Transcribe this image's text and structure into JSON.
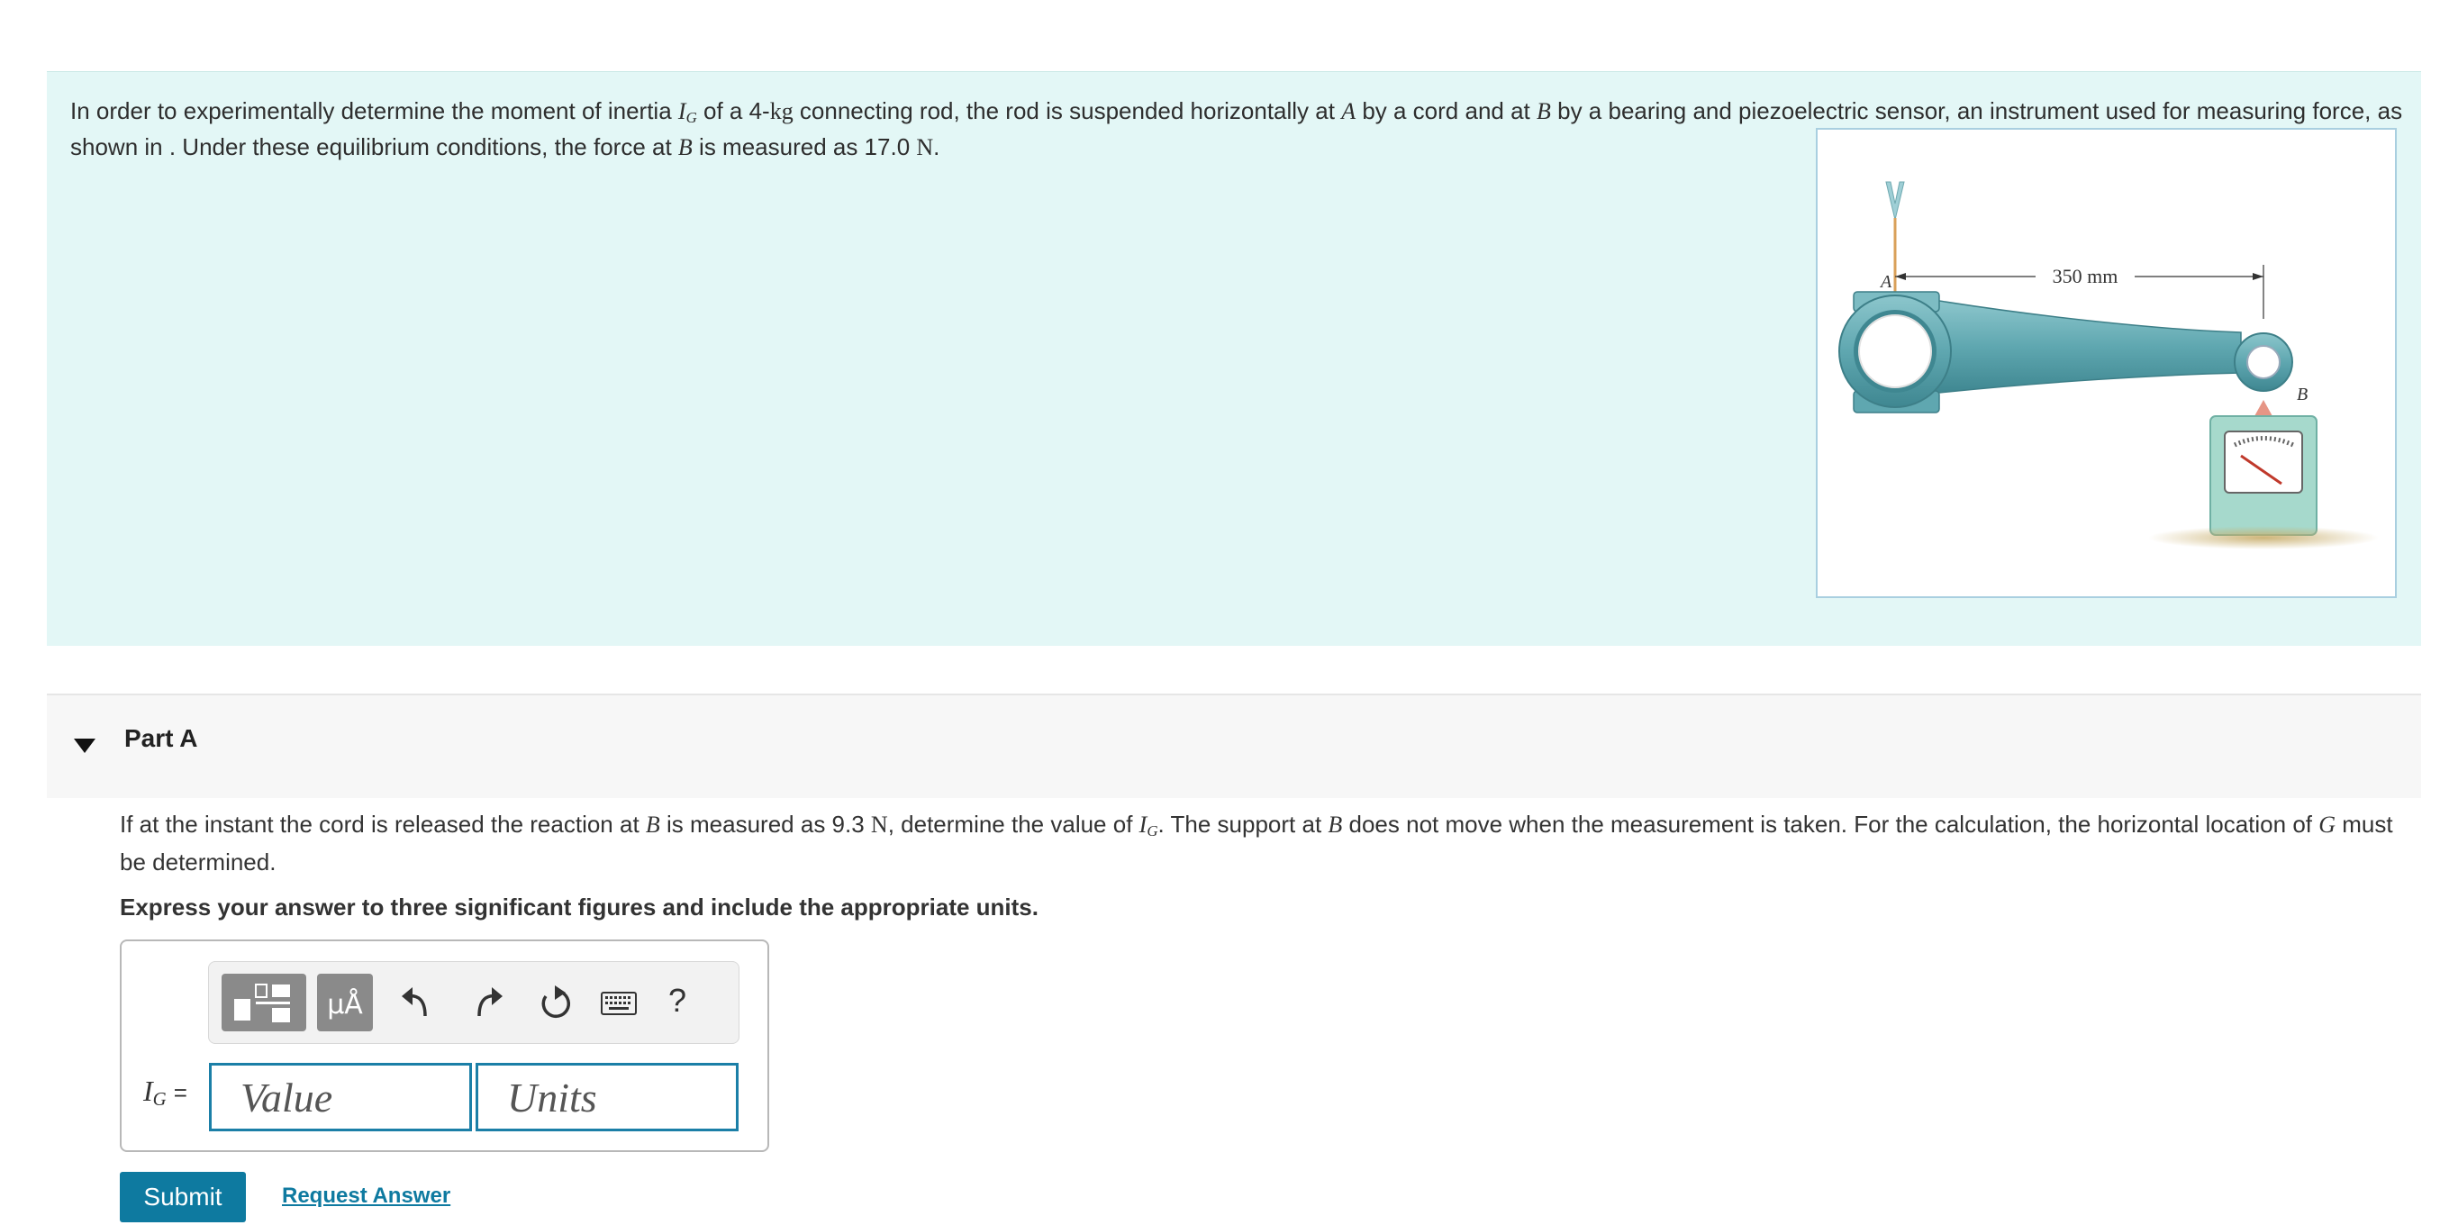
{
  "intro": {
    "text_1": "In order to experimentally determine the moment of inertia ",
    "ig_symbol": "I",
    "ig_sub": "G",
    "text_2": " of a 4-",
    "kg": "kg",
    "text_3": " connecting rod, the rod is suspended horizontally at ",
    "a_symbol": "A",
    "text_4": " by a cord and at ",
    "b_symbol": "B",
    "text_5": " by a bearing and piezoelectric sensor, an instrument used for measuring force, as shown in . Under these equilibrium conditions, the force at ",
    "b_symbol_2": "B",
    "text_6": " is measured as 17.0 ",
    "n_unit": "N",
    "text_7": "."
  },
  "figure": {
    "dimension_label": "350 mm",
    "label_a": "A",
    "label_b": "B",
    "colors": {
      "rod": "#5fa7b0",
      "rod_dark": "#3f8791",
      "cord": "#d9a05a",
      "sensor": "#a6d9cc",
      "shadow": "#c8ad6a",
      "tip": "#e69585"
    }
  },
  "partA": {
    "title": "Part A",
    "question": {
      "t1": "If at the instant the cord is released the reaction at ",
      "b": "B",
      "t2": " is measured as 9.3 ",
      "n": "N",
      "t3": ", determine the value of ",
      "ig": "I",
      "ig_sub": "G",
      "t4": ". The support at ",
      "b2": "B",
      "t5": " does not move when the measurement is taken. For the calculation, the horizontal location of ",
      "g": "G",
      "t6": " must be determined."
    },
    "instruction": "Express your answer to three significant figures and include the appropriate units.",
    "toolbar": {
      "units_label": "μÅ",
      "help_label": "?",
      "icons": [
        "templates-icon",
        "units-icon",
        "undo-icon",
        "redo-icon",
        "reset-icon",
        "keyboard-icon",
        "help-icon"
      ]
    },
    "answer": {
      "var_symbol": "I",
      "var_sub": "G",
      "equals": "=",
      "value_placeholder": "Value",
      "units_placeholder": "Units"
    },
    "submit_label": "Submit",
    "request_label": "Request Answer"
  },
  "colors": {
    "intro_bg": "#e3f7f6",
    "accent": "#0e7aa0",
    "input_border": "#1b7fa7"
  }
}
